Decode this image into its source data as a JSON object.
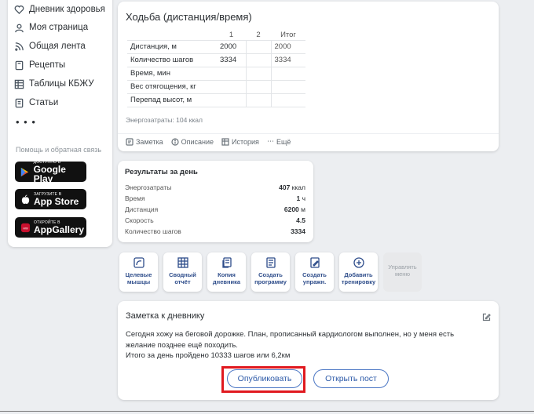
{
  "sidebar": {
    "items": [
      {
        "label": "Дневник здоровья",
        "icon": "heart-icon"
      },
      {
        "label": "Моя страница",
        "icon": "user-icon"
      },
      {
        "label": "Общая лента",
        "icon": "rss-icon"
      },
      {
        "label": "Рецепты",
        "icon": "book-icon"
      },
      {
        "label": "Таблицы КБЖУ",
        "icon": "table-icon"
      },
      {
        "label": "Статьи",
        "icon": "doc-icon"
      }
    ],
    "more": "• • •",
    "help": "Помощь и обратная связь",
    "stores": [
      {
        "small": "ДОСТУПНО В",
        "big": "Google Play"
      },
      {
        "small": "Загрузите в",
        "big": "App Store"
      },
      {
        "small": "ОТКРОЙТЕ В",
        "big": "AppGallery"
      }
    ]
  },
  "activity": {
    "title": "Ходьба (дистанция/время)",
    "columns": [
      "1",
      "2",
      "Итог"
    ],
    "rows": [
      {
        "label": "Дистанция, м",
        "v1": "2000",
        "v2": "",
        "total": "2000"
      },
      {
        "label": "Количество шагов",
        "v1": "3334",
        "v2": "",
        "total": "3334"
      },
      {
        "label": "Время, мин",
        "v1": "",
        "v2": "",
        "total": ""
      },
      {
        "label": "Вес отягощения, кг",
        "v1": "",
        "v2": "",
        "total": ""
      },
      {
        "label": "Перепад высот, м",
        "v1": "",
        "v2": "",
        "total": ""
      }
    ],
    "energy": "Энергозатраты: 104 ккал",
    "actions": [
      "Заметка",
      "Описание",
      "История",
      "Ещё"
    ]
  },
  "results": {
    "title": "Результаты за день",
    "rows": [
      {
        "key": "Энергозатраты",
        "value": "407",
        "unit": " ккал"
      },
      {
        "key": "Время",
        "value": "1",
        "unit": " ч"
      },
      {
        "key": "Дистанция",
        "value": "6200",
        "unit": " м"
      },
      {
        "key": "Скорость",
        "value": "4.5",
        "unit": ""
      },
      {
        "key": "Количество шагов",
        "value": "3334",
        "unit": ""
      }
    ]
  },
  "tiles": [
    {
      "label": "Целевые мышцы",
      "icon": "muscle-icon"
    },
    {
      "label": "Сводный отчёт",
      "icon": "grid-icon"
    },
    {
      "label": "Копия дневника",
      "icon": "copy-icon"
    },
    {
      "label": "Создать программу",
      "icon": "program-icon"
    },
    {
      "label": "Создать упражн.",
      "icon": "pencil-icon"
    },
    {
      "label": "Добавить тренировку",
      "icon": "plus-circle-icon"
    },
    {
      "label": "Управлять меню",
      "icon": ""
    }
  ],
  "note": {
    "title": "Заметка к дневнику",
    "lines": [
      "Сегодня хожу на беговой дорожке. План, прописанный кардиологом выполнен, но у меня есть",
      "желание позднее ещё походить.",
      "Итого за день пройдено 10333 шагов или 6,2км"
    ],
    "publish": "Опубликовать",
    "open_post": "Открыть пост"
  },
  "colors": {
    "accent": "#2d5aa8",
    "highlight": "#e0191f"
  }
}
